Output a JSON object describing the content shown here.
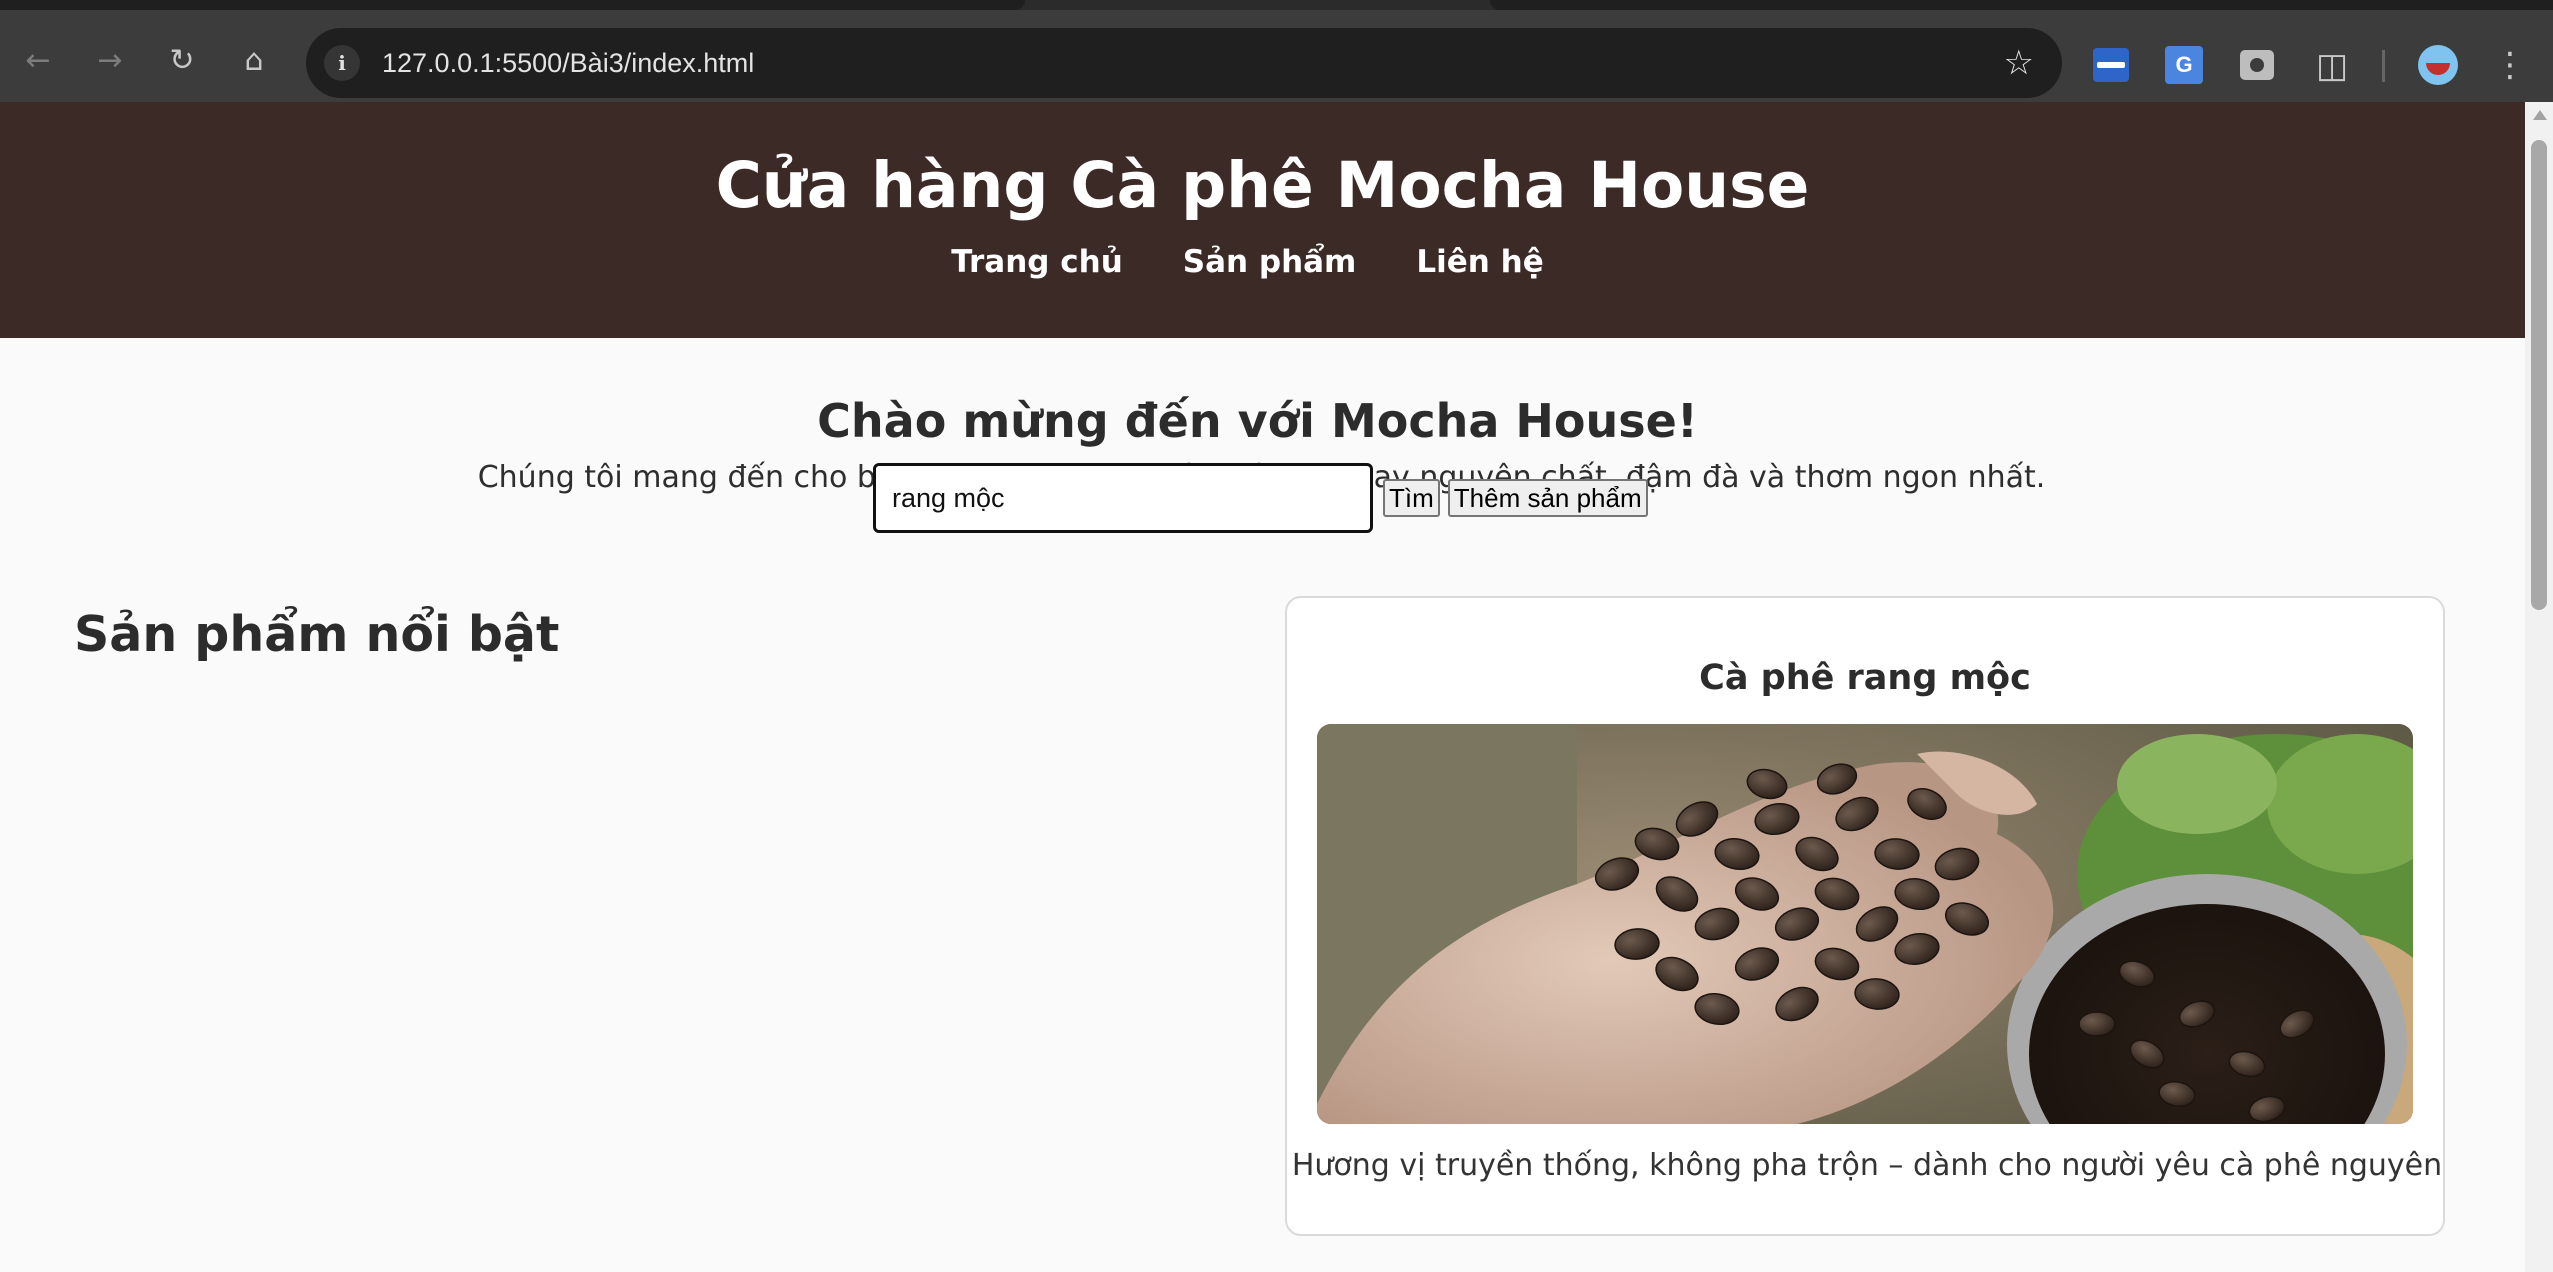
{
  "browser": {
    "url": "127.0.0.1:5500/Bài3/index.html",
    "icons": [
      "back-icon",
      "forward-icon",
      "reload-icon",
      "home-icon",
      "site-info-icon",
      "bookmark-star-icon",
      "extension-icon",
      "translate-icon",
      "camera-icon",
      "puzzle-icon",
      "profile-avatar",
      "menu-icon"
    ],
    "translate_ext_label": "G"
  },
  "header": {
    "title": "Cửa hàng Cà phê Mocha House",
    "nav": [
      "Trang chủ",
      "Sản phẩm",
      "Liên hệ"
    ]
  },
  "welcome": {
    "heading": "Chào mừng đến với Mocha House!",
    "text": "Chúng tôi mang đến cho bạn những hương vị cà phê rang xay nguyên chất, đậm đà và thơm ngon nhất."
  },
  "search": {
    "value": "rang mộc",
    "search_button": "Tìm",
    "add_button": "Thêm sản phẩm"
  },
  "featured": {
    "title": "Sản phẩm nổi bật",
    "products": [
      {
        "name": "Cà phê rang mộc",
        "image_alt": "coffee-beans-in-hand",
        "description": "Hương vị truyền thống, không pha trộn – dành cho người yêu cà phê nguyên"
      }
    ]
  },
  "colors": {
    "header_bg": "#3b2a26",
    "page_bg": "#fafafa",
    "chrome_bg": "#3c3c3c",
    "omnibox_bg": "#1f1f1f"
  }
}
